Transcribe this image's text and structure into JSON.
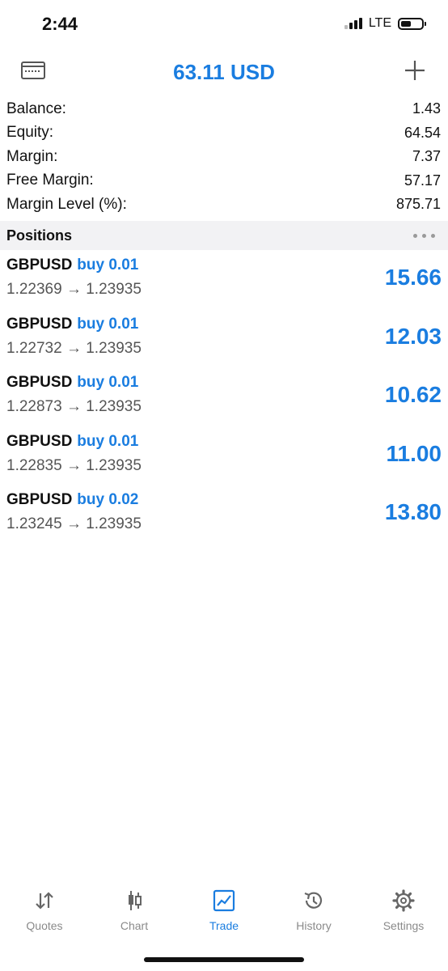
{
  "status_bar": {
    "time": "2:44",
    "network": "LTE",
    "battery_percent": 50
  },
  "header": {
    "title": "63.11 USD",
    "left_icon": "card-icon",
    "right_icon": "plus-icon"
  },
  "summary": [
    {
      "label": "Balance:",
      "value": "1.43"
    },
    {
      "label": "Equity:",
      "value": "64.54"
    },
    {
      "label": "Margin:",
      "value": "7.37"
    },
    {
      "label": "Free Margin:",
      "value": "57.17"
    },
    {
      "label": "Margin Level (%):",
      "value": "875.71"
    }
  ],
  "positions_header": {
    "title": "Positions"
  },
  "positions": [
    {
      "symbol": "GBPUSD",
      "side": "buy 0.01",
      "prices": "1.22369 → 1.23935",
      "profit": "15.66"
    },
    {
      "symbol": "GBPUSD",
      "side": "buy 0.01",
      "prices": "1.22732 → 1.23935",
      "profit": "12.03"
    },
    {
      "symbol": "GBPUSD",
      "side": "buy 0.01",
      "prices": "1.22873 → 1.23935",
      "profit": "10.62"
    },
    {
      "symbol": "GBPUSD",
      "side": "buy 0.01",
      "prices": "1.22835 → 1.23935",
      "profit": "11.00"
    },
    {
      "symbol": "GBPUSD",
      "side": "buy 0.02",
      "prices": "1.23245 → 1.23935",
      "profit": "13.80"
    }
  ],
  "tabs": [
    {
      "label": "Quotes",
      "icon": "quotes-arrows-icon",
      "active": false
    },
    {
      "label": "Chart",
      "icon": "candlestick-icon",
      "active": false
    },
    {
      "label": "Trade",
      "icon": "trade-chart-icon",
      "active": true
    },
    {
      "label": "History",
      "icon": "history-clock-icon",
      "active": false
    },
    {
      "label": "Settings",
      "icon": "gear-icon",
      "active": false
    }
  ],
  "colors": {
    "accent": "#1a7de0",
    "section_bg": "#f2f2f4",
    "text": "#111111",
    "secondary_text": "#555555",
    "inactive_tab": "#8a8a8a"
  }
}
